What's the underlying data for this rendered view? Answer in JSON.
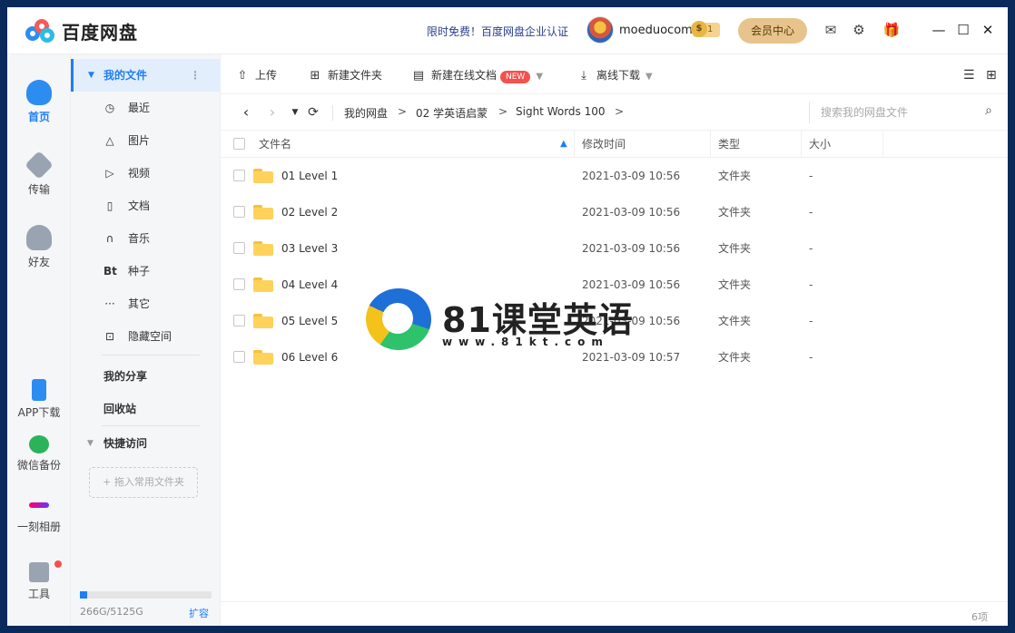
{
  "app": {
    "name": "百度网盘"
  },
  "titlebar": {
    "promo": "限时免费！百度网盘企业认证",
    "username": "moeduocom",
    "vip_level": "1",
    "member_center": "会员中心"
  },
  "rail": {
    "home": "首页",
    "transfer": "传输",
    "friends": "好友",
    "app_download": "APP下载",
    "wechat_backup": "微信备份",
    "album": "一刻相册",
    "tools": "工具"
  },
  "sidebar": {
    "my_files": "我的文件",
    "items": [
      {
        "label": "最近",
        "icon": "clock-icon"
      },
      {
        "label": "图片",
        "icon": "image-icon"
      },
      {
        "label": "视频",
        "icon": "play-icon"
      },
      {
        "label": "文档",
        "icon": "document-icon"
      },
      {
        "label": "音乐",
        "icon": "headphones-icon"
      },
      {
        "label": "种子",
        "icon": "bt-icon"
      },
      {
        "label": "其它",
        "icon": "more-icon"
      },
      {
        "label": "隐藏空间",
        "icon": "lock-icon"
      }
    ],
    "my_share": "我的分享",
    "recycle_bin": "回收站",
    "quick_access": "快捷访问",
    "dropzone": "+ 拖入常用文件夹",
    "storage": {
      "text": "266G/5125G",
      "used_fraction": 0.052
    },
    "expand": "扩容"
  },
  "toolbar": {
    "upload": "上传",
    "new_folder": "新建文件夹",
    "new_doc": "新建在线文档",
    "new_badge": "NEW",
    "offline_download": "离线下载"
  },
  "breadcrumb": [
    "我的网盘",
    "02 学英语启蒙",
    "Sight Words 100"
  ],
  "search": {
    "placeholder": "搜索我的网盘文件"
  },
  "table": {
    "headers": {
      "name": "文件名",
      "modified": "修改时间",
      "type": "类型",
      "size": "大小"
    },
    "rows": [
      {
        "name": "01 Level 1",
        "modified": "2021-03-09 10:56",
        "type": "文件夹",
        "size": "-"
      },
      {
        "name": "02 Level 2",
        "modified": "2021-03-09 10:56",
        "type": "文件夹",
        "size": "-"
      },
      {
        "name": "03 Level 3",
        "modified": "2021-03-09 10:56",
        "type": "文件夹",
        "size": "-"
      },
      {
        "name": "04 Level 4",
        "modified": "2021-03-09 10:56",
        "type": "文件夹",
        "size": "-"
      },
      {
        "name": "05 Level 5",
        "modified": "2021-03-09 10:56",
        "type": "文件夹",
        "size": "-"
      },
      {
        "name": "06 Level 6",
        "modified": "2021-03-09 10:57",
        "type": "文件夹",
        "size": "-"
      }
    ]
  },
  "footer": {
    "count": "6项"
  },
  "watermark": {
    "title": "81课堂英语",
    "url": "www.81kt.com"
  },
  "colors": {
    "accent": "#1e7ef5",
    "folder": "#ffd25c",
    "member": "#e6c48c",
    "badge": "#f4514d"
  }
}
